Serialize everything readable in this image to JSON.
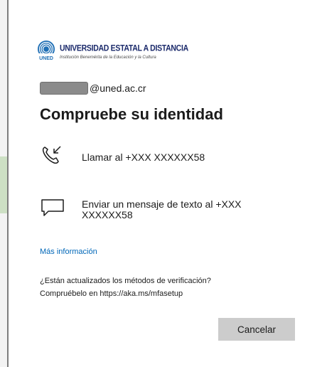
{
  "org": {
    "name": "UNIVERSIDAD ESTATAL A DISTANCIA",
    "subtitle": "Institución Benemérita de la Educación y la Cultura",
    "mark_text": "UNED",
    "brand_color": "#1b2a6b",
    "accent_color": "#1f6fb5"
  },
  "account": {
    "domain": "@uned.ac.cr"
  },
  "title": "Compruebe su identidad",
  "options": [
    {
      "icon": "phone-call-icon",
      "label": "Llamar al +XXX XXXXXX58"
    },
    {
      "icon": "message-icon",
      "label": "Enviar un mensaje de texto al +XXX XXXXXX58"
    }
  ],
  "more_info": "Más información",
  "verify_question": "¿Están actualizados los métodos de verificación?",
  "verify_link_text": "Compruébelo en https://aka.ms/mfasetup",
  "cancel_label": "Cancelar",
  "colors": {
    "link": "#0067b8",
    "button_bg": "#cccccc"
  }
}
